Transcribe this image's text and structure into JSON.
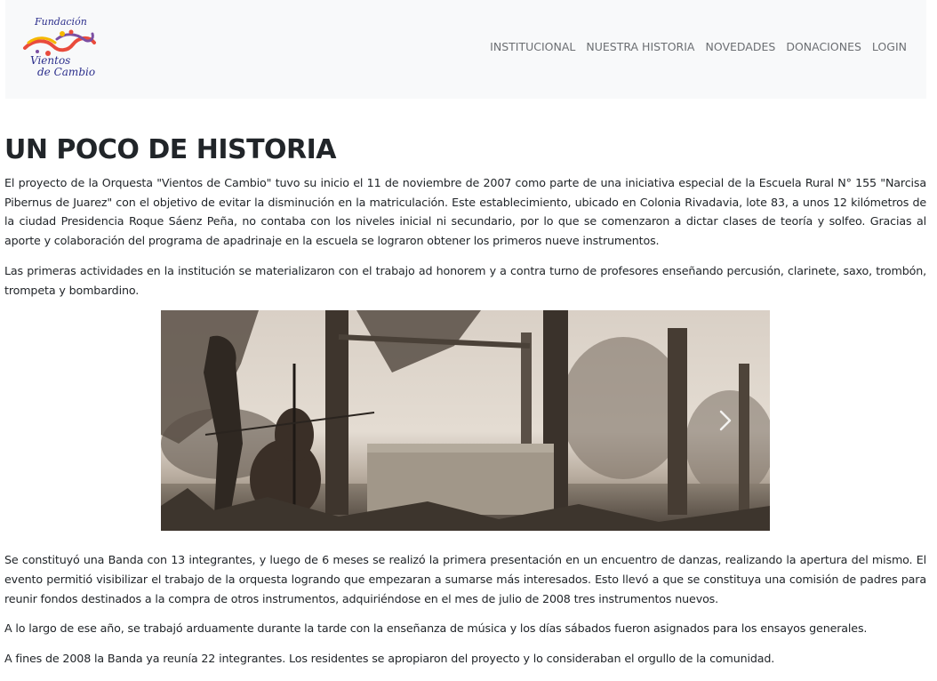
{
  "brand": {
    "logo_line1": "Fundación",
    "logo_line2": "Vientos",
    "logo_line3": "de Cambio",
    "logo_colors": [
      "#e94b3c",
      "#f5b800",
      "#7b4fa3",
      "#2c2f8c"
    ]
  },
  "nav": {
    "items": [
      {
        "label": "INSTITUCIONAL"
      },
      {
        "label": "NUESTRA HISTORIA"
      },
      {
        "label": "NOVEDADES"
      },
      {
        "label": "DONACIONES"
      },
      {
        "label": "LOGIN"
      }
    ]
  },
  "page": {
    "title": "UN POCO DE HISTORIA",
    "paragraphs_before": [
      "El proyecto de la Orquesta \"Vientos de Cambio\" tuvo su inicio el 11 de noviembre de 2007 como parte de una iniciativa especial de la Escuela Rural N° 155 \"Narcisa Pibernus de Juarez\" con el objetivo de evitar la disminución en la matriculación. Este establecimiento, ubicado en Colonia Rivadavia, lote 83, a unos 12 kilómetros de la ciudad Presidencia Roque Sáenz Peña, no contaba con los niveles inicial ni secundario, por lo que se comenzaron a dictar clases de teoría y solfeo. Gracias al aporte y colaboración del programa de apadrinaje en la escuela se lograron obtener los primeros nueve instrumentos.",
      "Las primeras actividades en la institución se materializaron con el trabajo ad honorem y a contra turno de profesores enseñando percusión, clarinete, saxo, trombón, trompeta y bombardino."
    ],
    "carousel": {
      "next_icon": "chevron-right-icon"
    },
    "paragraphs_after": [
      "Se constituyó una Banda con 13 integrantes, y luego de 6 meses se realizó la primera presentación en un encuentro de danzas, realizando la apertura del mismo. El evento permitió visibilizar el trabajo de la orquesta logrando que empezaran a sumarse más interesados. Esto llevó a que se constituya una comisión de padres para reunir fondos destinados a la compra de otros instrumentos, adquiriéndose en el mes de julio de 2008 tres instrumentos nuevos.",
      "A lo largo de ese año, se trabajó arduamente durante la tarde con la enseñanza de música y los días sábados fueron asignados para los ensayos generales.",
      "A fines de 2008 la Banda ya reunía 22 integrantes. Los residentes se apropiaron del proyecto y lo consideraban el orgullo de la comunidad."
    ]
  }
}
